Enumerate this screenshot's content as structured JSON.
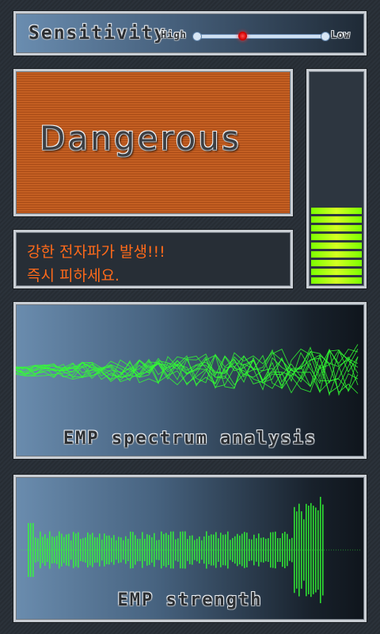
{
  "sensitivity": {
    "title": "Sensitivity",
    "high_label": "High",
    "low_label": "Low",
    "value": 0.36
  },
  "alert": {
    "status": "Dangerous"
  },
  "meter": {
    "level": 0.36
  },
  "message": {
    "line1": "강한 전자파가 발생!!!",
    "line2": "즉시 피하세요."
  },
  "spectrum": {
    "label": "EMP spectrum analysis"
  },
  "strength": {
    "label": "EMP strength"
  },
  "colors": {
    "signal_green": "#33ff33",
    "alert_orange": "#c45f22",
    "message_text": "#ff6a1a",
    "slider_thumb": "#e00000"
  }
}
